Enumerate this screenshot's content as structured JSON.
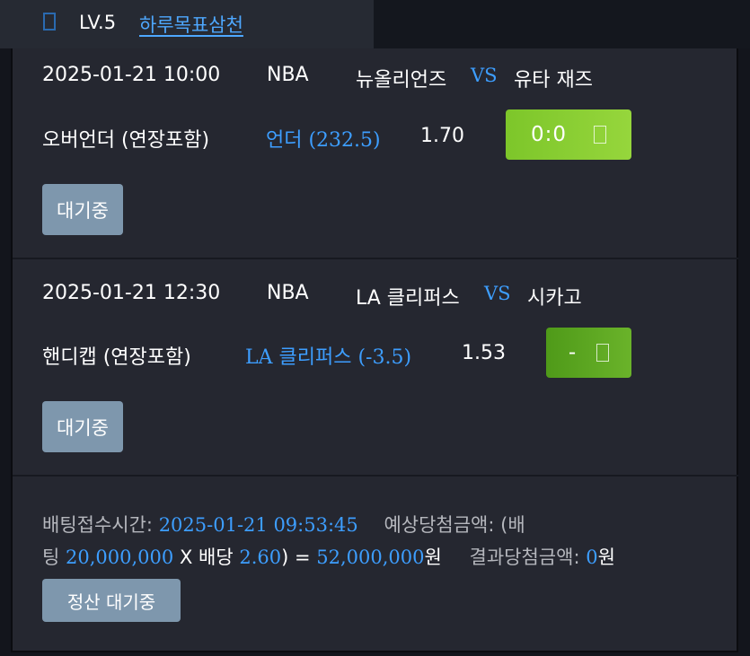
{
  "header": {
    "level": "LV.5",
    "username": "하루목표삼천"
  },
  "bets": [
    {
      "datetime": "2025-01-21 10:00",
      "league": "NBA",
      "home": "뉴올리언즈",
      "vs": "VS",
      "away": "유타 재즈",
      "market": "오버언더 (연장포함)",
      "pick": "언더 (232.5)",
      "odds": "1.70",
      "score": "0:0",
      "status": "대기중"
    },
    {
      "datetime": "2025-01-21 12:30",
      "league": "NBA",
      "home": "LA 클리퍼스",
      "vs": "VS",
      "away": "시카고",
      "market": "핸디캡 (연장포함)",
      "pick": "LA 클리퍼스 (-3.5)",
      "odds": "1.53",
      "score": "-",
      "status": "대기중"
    }
  ],
  "summary": {
    "time_label": "배팅접수시간:",
    "time_value": "2025-01-21 09:53:45",
    "expected_label": "예상당첨금액: (배",
    "expected_label2": "팅",
    "stake": "20,000,000",
    "times": "X 배당",
    "total_odds": "2.60",
    "equals": ") =",
    "expected_amount": "52,000,000",
    "won": "원",
    "result_label": "결과당첨금액:",
    "result_amount": "0",
    "result_won": "원",
    "settle_status": "정산 대기중"
  },
  "colors": {
    "accent_blue": "#3d9eff",
    "green": "#8acf33",
    "status_gray": "#7e97ad"
  }
}
